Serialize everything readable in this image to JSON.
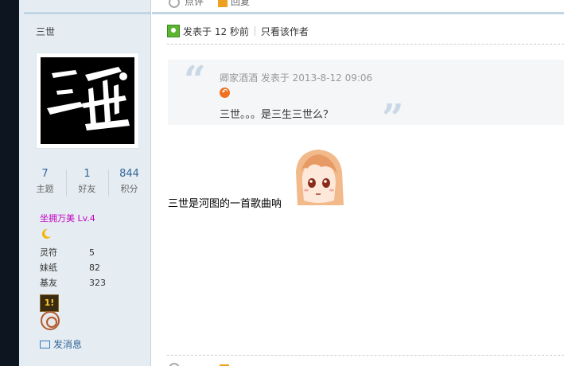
{
  "top_actions": {
    "like_label": "点评",
    "reply_label": "回复"
  },
  "user": {
    "name": "三世",
    "avatar_text": "三世",
    "stats": [
      {
        "value": "7",
        "label": "主题"
      },
      {
        "value": "1",
        "label": "好友"
      },
      {
        "value": "844",
        "label": "积分"
      }
    ],
    "rank": "坐拥万美 Lv.4",
    "info": [
      {
        "key": "灵符",
        "value": "5"
      },
      {
        "key": "妹纸",
        "value": "82"
      },
      {
        "key": "基友",
        "value": "323"
      }
    ],
    "medal1_text": "1!",
    "send_message": "发消息"
  },
  "post": {
    "posted_time": "发表于 12 秒前",
    "only_author": "只看该作者",
    "quote": {
      "author": "卿家酒酒",
      "posted": "发表于 2013-8-12 09:06",
      "text": "三世。。。是三生三世么？"
    },
    "body_text": "三世是河图的一首歌曲呐",
    "colors": {
      "link": "#336699",
      "rank": "#c000c0",
      "quote_bg": "#f4f6f8"
    }
  }
}
